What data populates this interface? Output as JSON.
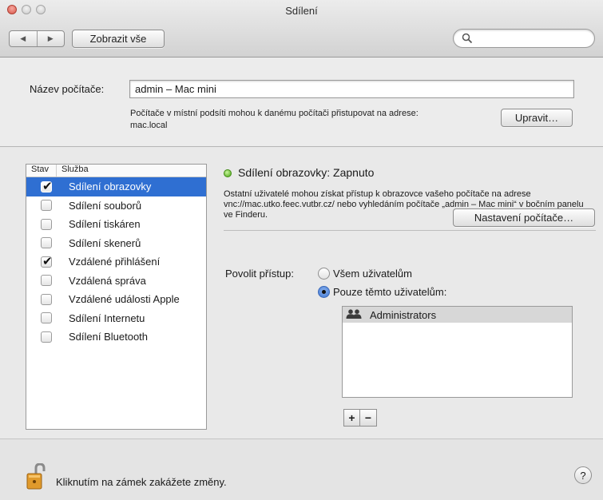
{
  "window": {
    "title": "Sdílení"
  },
  "toolbar": {
    "back_glyph": "◀",
    "forward_glyph": "▶",
    "show_all_label": "Zobrazit vše",
    "search_placeholder": ""
  },
  "computer": {
    "name_label": "Název počítače:",
    "name_value": "admin – Mac mini",
    "address_text": "Počítače v místní podsíti mohou k danému počítači přistupovat na adrese:",
    "address_value": "mac.local",
    "edit_button": "Upravit…"
  },
  "services": {
    "header_status": "Stav",
    "header_service": "Služba",
    "items": [
      {
        "label": "Sdílení obrazovky",
        "checked": true,
        "selected": true
      },
      {
        "label": "Sdílení souborů",
        "checked": false,
        "selected": false
      },
      {
        "label": "Sdílení tiskáren",
        "checked": false,
        "selected": false
      },
      {
        "label": "Sdílení skenerů",
        "checked": false,
        "selected": false
      },
      {
        "label": "Vzdálené přihlášení",
        "checked": true,
        "selected": false
      },
      {
        "label": "Vzdálená správa",
        "checked": false,
        "selected": false
      },
      {
        "label": "Vzdálené události Apple",
        "checked": false,
        "selected": false
      },
      {
        "label": "Sdílení Internetu",
        "checked": false,
        "selected": false
      },
      {
        "label": "Sdílení Bluetooth",
        "checked": false,
        "selected": false
      }
    ]
  },
  "detail": {
    "status": "Sdílení obrazovky: Zapnuto",
    "status_color": "#4aa514",
    "description": "Ostatní uživatelé mohou získat přístup k obrazovce vašeho počítače na adrese vnc://mac.utko.feec.vutbr.cz/ nebo vyhledáním počítače „admin – Mac mini“ v bočním panelu ve Finderu.",
    "computer_settings_button": "Nastavení počítače…",
    "allow_access_label": "Povolit přístup:",
    "radio_all_users": "Všem uživatelům",
    "radio_only_users": "Pouze těmto uživatelům:",
    "selected_radio": "only",
    "users": [
      "Administrators"
    ],
    "add_label": "+",
    "remove_label": "−"
  },
  "footer": {
    "lock_text": "Kliknutím na zámek zakážete změny.",
    "help_label": "?"
  },
  "colors": {
    "selection": "#2f6fd2",
    "window_bg": "#e9e9e9"
  }
}
